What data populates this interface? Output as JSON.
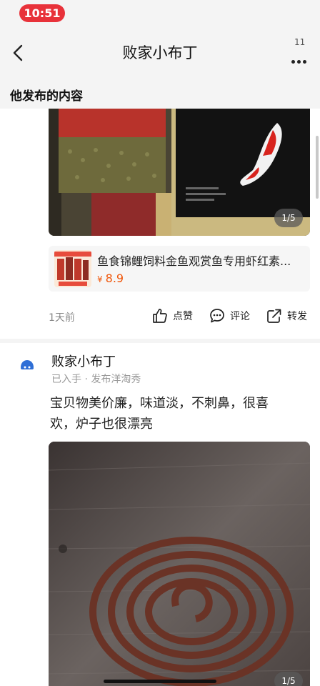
{
  "status_bar": {
    "time": "10:51"
  },
  "nav": {
    "title": "败家小布丁",
    "more_count": "11"
  },
  "section": {
    "heading": "他发布的内容"
  },
  "post1": {
    "image_counter": "1/5",
    "product": {
      "title": "鱼食锦鲤饲料金鱼观赏鱼专用虾红素...",
      "currency": "¥",
      "price": "8.9"
    },
    "time_ago": "1天前",
    "actions": {
      "like": "点赞",
      "comment": "评论",
      "share": "转发"
    }
  },
  "post2": {
    "username": "败家小布丁",
    "meta": "已入手 · 发布洋淘秀",
    "text": "宝贝物美价廉，味道淡，不刺鼻，很喜欢，炉子也很漂亮",
    "image_counter": "1/5"
  },
  "colors": {
    "time_pill": "#e8323a",
    "price": "#f0560a"
  }
}
